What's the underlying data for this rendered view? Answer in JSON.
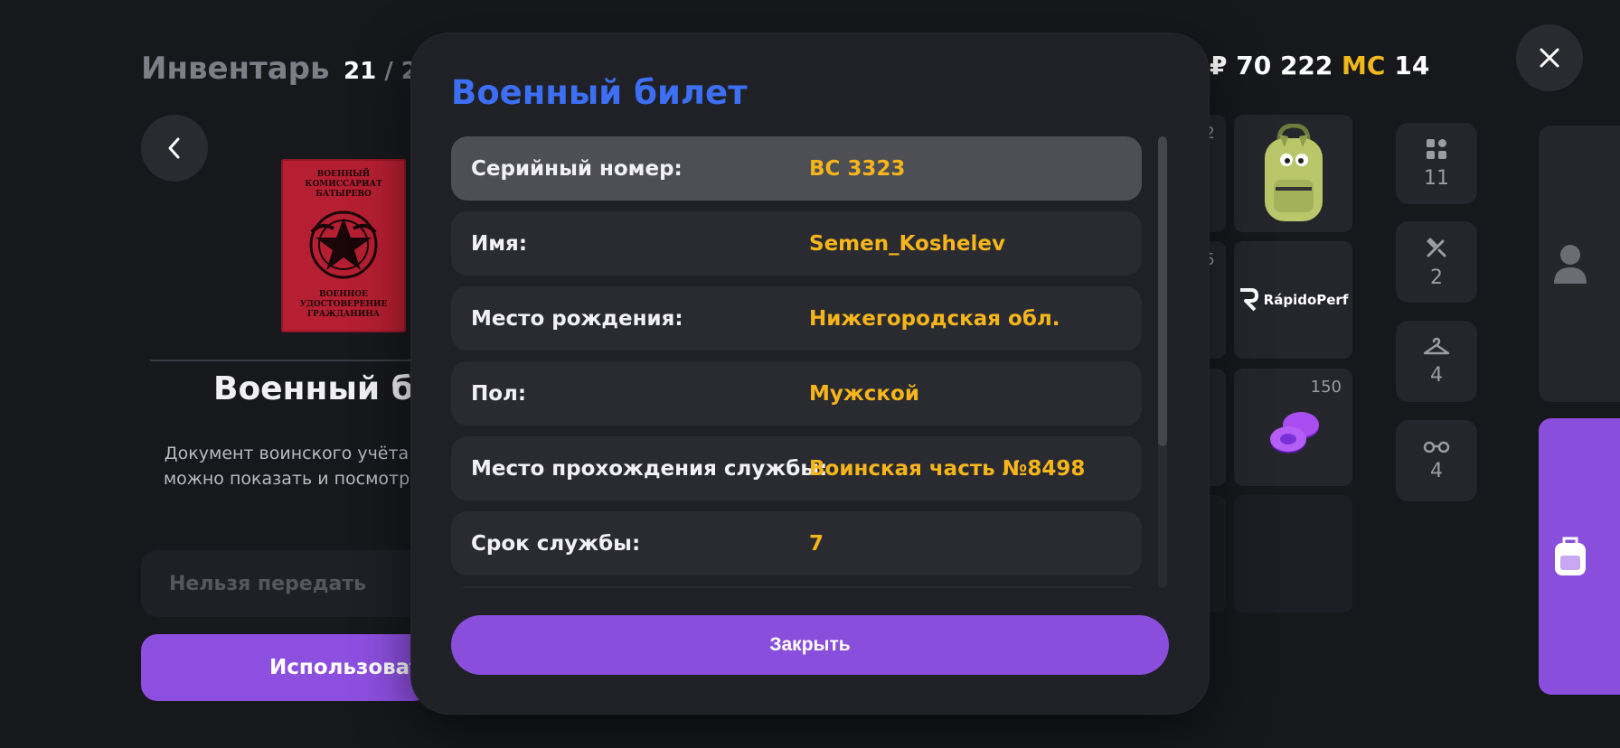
{
  "inventory": {
    "title": "Инвентарь",
    "count_current": "21",
    "count_max": "2"
  },
  "currency": {
    "money": "₽ 70 222",
    "mc_label": "MC",
    "mc_value": "14"
  },
  "selected_item": {
    "name": "Военный би",
    "description_line1": "Документ воинского учёта",
    "description_line2": "можно показать и посмотр",
    "cover_top_line1": "ВОЕННЫЙ КОМИССАРИАТ",
    "cover_top_line2": "БАТЫРЕВО",
    "cover_bottom_line1": "ВОЕННОЕ УДОСТОВЕРЕНИЕ",
    "cover_bottom_line2": "ГРАЖДАНИНА",
    "transfer_label": "Нельзя передать",
    "use_label": "Использовать"
  },
  "grid_slots": [
    {
      "count": "2"
    },
    {
      "count": "5"
    },
    {
      "count": ""
    },
    {
      "count": "150",
      "icon": "chip-stack-icon"
    },
    {
      "logo_text": "RápidoPerf",
      "icon": "rapidoperf-logo"
    },
    {
      "icon": "backpack-item-icon"
    }
  ],
  "categories": [
    {
      "icon": "grid-icon",
      "count": "11"
    },
    {
      "icon": "food-icon",
      "count": "2"
    },
    {
      "icon": "hanger-icon",
      "count": "4"
    },
    {
      "icon": "glasses-icon",
      "count": "4"
    }
  ],
  "side_tabs": [
    {
      "icon": "person-icon",
      "active": false
    },
    {
      "icon": "backpack-icon",
      "active": true
    }
  ],
  "modal": {
    "title": "Военный билет",
    "rows": [
      {
        "label": "Серийный номер:",
        "value": "ВС 3323"
      },
      {
        "label": "Имя:",
        "value": "Semen_Koshelev"
      },
      {
        "label": "Место рождения:",
        "value": "Нижегородская обл."
      },
      {
        "label": "Пол:",
        "value": "Мужской"
      },
      {
        "label": "Место прохождения службы:",
        "value": "Воинская часть №8498"
      },
      {
        "label": "Срок службы:",
        "value": "7"
      }
    ],
    "close_label": "Закрыть"
  },
  "colors": {
    "accent_purple": "#8a4edc",
    "title_blue": "#3d6ff5",
    "value_yellow": "#f5b51b",
    "mc_yellow": "#f1b81b"
  }
}
